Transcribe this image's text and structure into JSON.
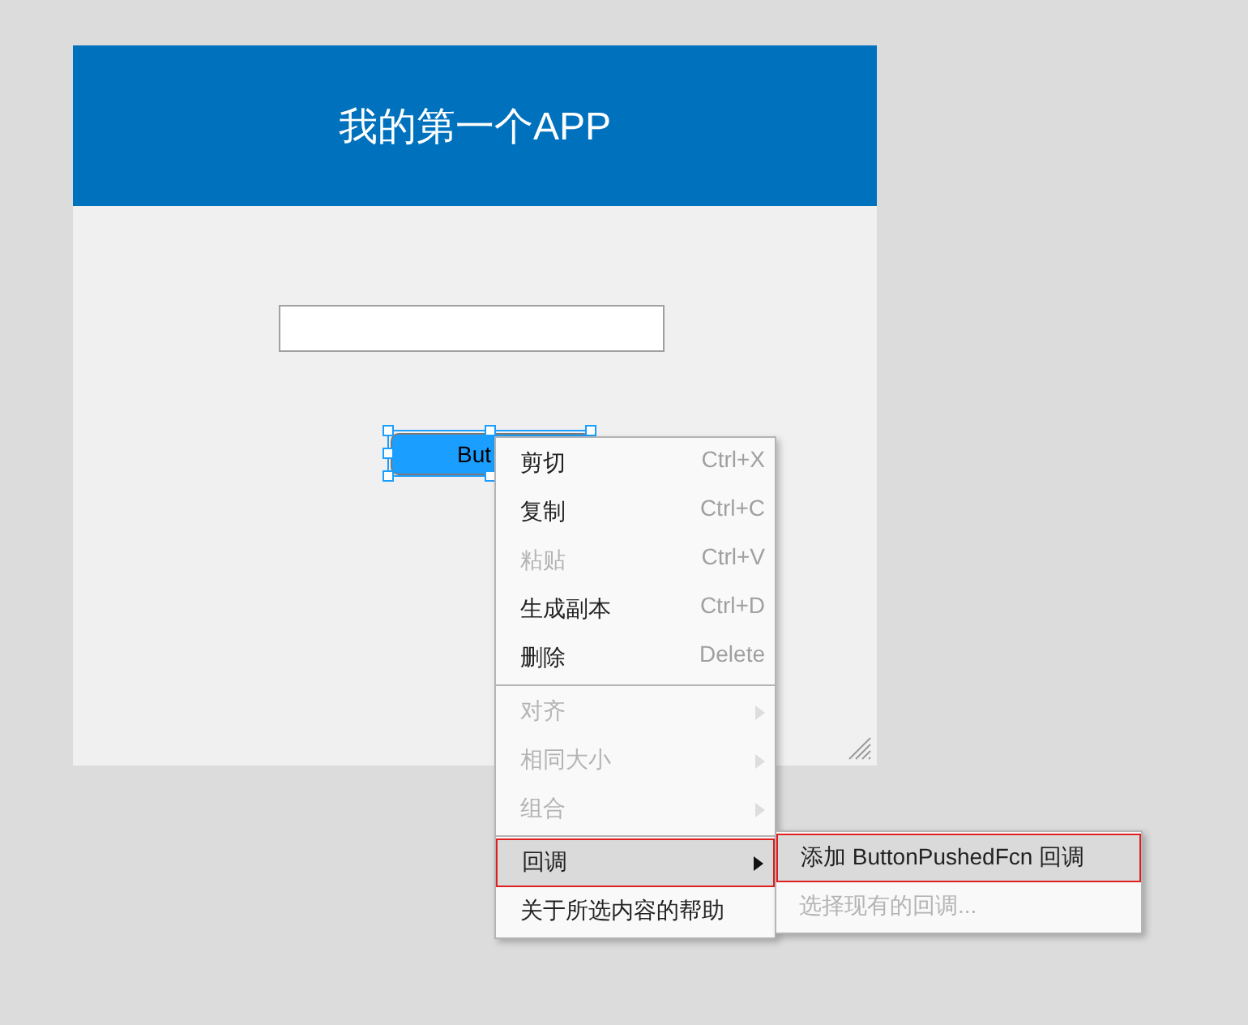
{
  "app_window": {
    "title": "我的第一个APP",
    "button": {
      "label": "But",
      "selected": true
    }
  },
  "context_menu": {
    "groups": [
      {
        "items": [
          {
            "label": "剪切",
            "shortcut": "Ctrl+X",
            "disabled": false,
            "has_submenu": false,
            "selected": false
          },
          {
            "label": "复制",
            "shortcut": "Ctrl+C",
            "disabled": false,
            "has_submenu": false,
            "selected": false
          },
          {
            "label": "粘贴",
            "shortcut": "Ctrl+V",
            "disabled": true,
            "has_submenu": false,
            "selected": false
          },
          {
            "label": "生成副本",
            "shortcut": "Ctrl+D",
            "disabled": false,
            "has_submenu": false,
            "selected": false
          },
          {
            "label": "删除",
            "shortcut": "Delete",
            "disabled": false,
            "has_submenu": false,
            "selected": false
          }
        ]
      },
      {
        "items": [
          {
            "label": "对齐",
            "disabled": true,
            "has_submenu": true,
            "selected": false
          },
          {
            "label": "相同大小",
            "disabled": true,
            "has_submenu": true,
            "selected": false
          },
          {
            "label": "组合",
            "disabled": true,
            "has_submenu": true,
            "selected": false
          }
        ]
      },
      {
        "items": [
          {
            "label": "回调",
            "disabled": false,
            "has_submenu": true,
            "selected": true
          },
          {
            "label": "关于所选内容的帮助",
            "disabled": false,
            "has_submenu": false,
            "selected": false
          }
        ]
      }
    ]
  },
  "submenu": {
    "items": [
      {
        "label": "添加 ButtonPushedFcn 回调",
        "disabled": false,
        "selected": true
      },
      {
        "label": "选择现有的回调...",
        "disabled": true,
        "selected": false
      }
    ]
  }
}
